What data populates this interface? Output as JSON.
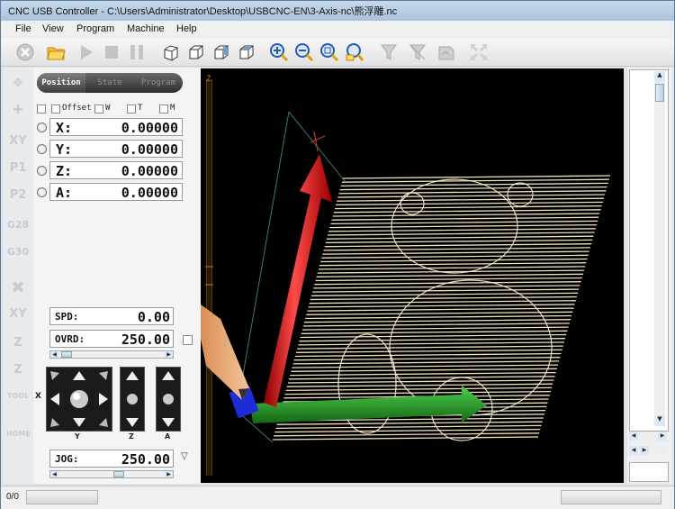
{
  "window": {
    "title": "CNC USB Controller - C:\\Users\\Administrator\\Desktop\\USBCNC-EN\\3-Axis-nc\\熊浮雕.nc"
  },
  "menu": [
    "File",
    "View",
    "Program",
    "Machine",
    "Help"
  ],
  "toolbar": {
    "icons": [
      "stop-icon",
      "open-folder-icon",
      "play-icon",
      "stop-square-icon",
      "pause-icon",
      "cube-iso-icon",
      "cube-front-icon",
      "cube-side-icon",
      "cube-top-icon",
      "zoom-in-icon",
      "zoom-out-icon",
      "zoom-fit-icon",
      "zoom-window-icon",
      "filter-icon",
      "funnel-icon",
      "view-icon",
      "fullscreen-icon"
    ]
  },
  "sidebar": {
    "labels": [
      "",
      "",
      "XY",
      "P1",
      "P2",
      "G28",
      "G30",
      "",
      "XY",
      "Z",
      "Z",
      "TOOL",
      "HOME"
    ]
  },
  "panel": {
    "tabs": [
      {
        "label": "Position"
      },
      {
        "label": "State"
      },
      {
        "label": "Program"
      }
    ],
    "checkboxes": [
      {
        "label": "Offset"
      },
      {
        "label": "W"
      },
      {
        "label": "T"
      },
      {
        "label": "M"
      }
    ],
    "coords": [
      {
        "axis": "X:",
        "value": "0.00000"
      },
      {
        "axis": "Y:",
        "value": "0.00000"
      },
      {
        "axis": "Z:",
        "value": "0.00000"
      },
      {
        "axis": "A:",
        "value": "0.00000"
      }
    ],
    "spd": {
      "label": "SPD:",
      "value": "0.00"
    },
    "ovrd": {
      "label": "OVRD:",
      "value": "250.00"
    },
    "jog": {
      "label": "JOG:",
      "value": "250.00"
    },
    "jog_axes": {
      "x": "X",
      "y": "Y",
      "z": "Z",
      "a": "A"
    }
  },
  "viewport": {
    "axis_label": "Z"
  },
  "status": {
    "text": "0/0"
  }
}
